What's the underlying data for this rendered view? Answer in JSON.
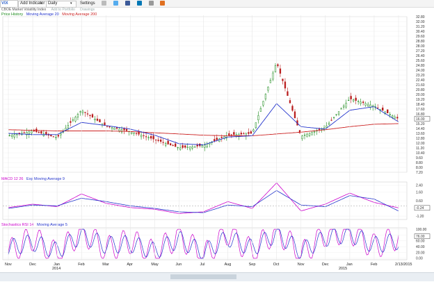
{
  "toolbar": {
    "symbol": "VIX",
    "add_indicator": "Add Indicator",
    "period": "Daily",
    "settings": "Settings",
    "social_icons": [
      "print-icon",
      "twitter-icon",
      "facebook-icon",
      "linkedin-icon",
      "email-icon",
      "share-icon"
    ]
  },
  "subtitle": {
    "name": "CBOE Market Volatility Index",
    "links": [
      "Add to Portfolio",
      "Drawings"
    ]
  },
  "price_panel": {
    "legend": [
      "Price History",
      "Moving Average 20",
      "Moving Average 200"
    ],
    "legend_colors": [
      "#1a8a1a",
      "#2233cc",
      "#cc2222"
    ],
    "current_value": "16.00",
    "y_ticks": [
      "32.80",
      "32.00",
      "31.20",
      "30.40",
      "29.60",
      "28.80",
      "28.00",
      "27.20",
      "26.40",
      "25.60",
      "24.80",
      "24.00",
      "23.20",
      "22.40",
      "21.60",
      "20.80",
      "20.00",
      "19.20",
      "18.40",
      "17.60",
      "16.80",
      "16.00",
      "15.20",
      "14.40",
      "13.60",
      "12.80",
      "12.00",
      "11.20",
      "10.40",
      "9.60",
      "8.80",
      "8.00",
      "7.20"
    ]
  },
  "macd_panel": {
    "legend": [
      "MACD 12 26",
      "Exp Moving Average 9"
    ],
    "legend_colors": [
      "#cc00cc",
      "#2233cc"
    ],
    "current_value": "-0.24",
    "y_ticks": [
      "2.40",
      "1.60",
      "0.60",
      "-1.20"
    ]
  },
  "stoch_panel": {
    "legend": [
      "Stochastics RSI 14",
      "Moving Average 5"
    ],
    "legend_colors": [
      "#cc00cc",
      "#2233cc"
    ],
    "current_value": "76.00",
    "y_ticks": [
      "100.00",
      "80.00",
      "60.00",
      "40.00",
      "20.00",
      "0.00"
    ]
  },
  "x_axis": {
    "months": [
      "Nov",
      "Dec",
      "Jan",
      "Feb",
      "Mar",
      "Apr",
      "May",
      "Jun",
      "Jul",
      "Aug",
      "Sep",
      "Oct",
      "Nov",
      "Dec",
      "Jan",
      "Feb",
      "2/13/2015"
    ],
    "years": [
      "2014",
      "2015"
    ]
  },
  "chart_data": {
    "type": "line",
    "title": "",
    "xlabel": "",
    "ylabel": "",
    "x": [
      "Nov",
      "Dec",
      "Jan",
      "Feb",
      "Mar",
      "Apr",
      "May",
      "Jun",
      "Jul",
      "Aug",
      "Sep",
      "Oct",
      "Nov",
      "Dec",
      "Jan",
      "Feb",
      "2/13/2015"
    ],
    "series": [
      {
        "name": "Price History",
        "values": [
          13.2,
          14.0,
          12.9,
          17.4,
          14.8,
          13.9,
          12.6,
          11.2,
          11.6,
          13.3,
          13.6,
          25.3,
          13.1,
          14.6,
          19.3,
          18.1,
          16.0
        ]
      },
      {
        "name": "Moving Average 20",
        "values": [
          13.6,
          13.4,
          13.4,
          15.4,
          14.9,
          14.3,
          13.3,
          11.9,
          11.7,
          13.0,
          13.2,
          18.5,
          14.7,
          14.3,
          17.4,
          18.0,
          15.5
        ]
      },
      {
        "name": "Moving Average 200",
        "values": [
          14.2,
          14.1,
          14.0,
          14.0,
          14.0,
          13.9,
          13.7,
          13.5,
          13.3,
          13.2,
          13.2,
          13.5,
          13.8,
          14.2,
          14.7,
          15.1,
          15.2
        ]
      },
      {
        "name": "MACD 12 26",
        "values": [
          -0.2,
          0.2,
          -0.1,
          1.4,
          0.3,
          -0.2,
          -0.4,
          -0.9,
          -0.7,
          0.5,
          -0.3,
          2.7,
          -0.6,
          0.2,
          1.5,
          0.4,
          -0.24
        ]
      },
      {
        "name": "Exp Moving Average 9",
        "values": [
          -0.3,
          0.1,
          0.0,
          0.9,
          0.5,
          0.0,
          -0.3,
          -0.7,
          -0.8,
          0.1,
          -0.1,
          1.8,
          0.1,
          -0.1,
          1.2,
          0.8,
          -0.6
        ]
      },
      {
        "name": "Stochastics RSI 14",
        "values": [
          20,
          70,
          10,
          95,
          30,
          60,
          15,
          80,
          5,
          90,
          20,
          100,
          10,
          85,
          95,
          40,
          76
        ]
      },
      {
        "name": "Moving Average 5",
        "values": [
          35,
          55,
          25,
          80,
          45,
          50,
          25,
          65,
          20,
          70,
          35,
          85,
          25,
          70,
          85,
          45,
          60
        ]
      }
    ],
    "ylim": [
      7.2,
      32.8
    ],
    "grid": true,
    "legend": "top-left"
  }
}
